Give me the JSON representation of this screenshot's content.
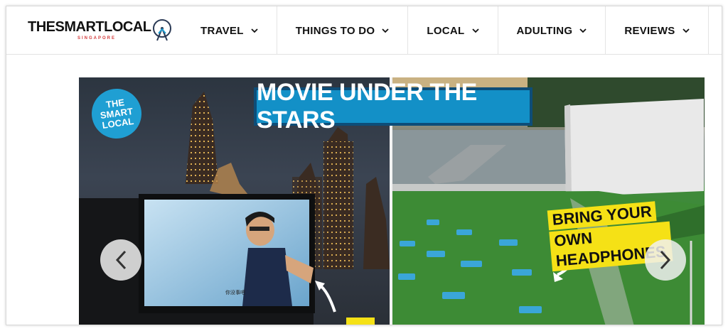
{
  "logo": {
    "brand_part1": "THE",
    "brand_part2": "SMART",
    "brand_part3": "LOCAL",
    "region": "SINGAPORE",
    "icon": "ferris-wheel-icon"
  },
  "nav": {
    "items": [
      {
        "label": "TRAVEL",
        "icon": "chevron-down-icon"
      },
      {
        "label": "THINGS TO DO",
        "icon": "chevron-down-icon"
      },
      {
        "label": "LOCAL",
        "icon": "chevron-down-icon"
      },
      {
        "label": "ADULTING",
        "icon": "chevron-down-icon"
      },
      {
        "label": "REVIEWS",
        "icon": "chevron-down-icon"
      }
    ]
  },
  "hero": {
    "badge_lines": [
      "THE",
      "SMART",
      "LOCAL"
    ],
    "title": "MOVIE UNDER THE STARS",
    "tag_line1": "BRING YOUR",
    "tag_line2": "OWN HEADPHONES",
    "subtitle_on_screen": "你没事吧",
    "prev_icon": "chevron-left-icon",
    "next_icon": "chevron-right-icon"
  },
  "colors": {
    "accent_blue": "#1390c7",
    "banner_dark": "#0d4d78",
    "tag_yellow": "#f5e116",
    "logo_red": "#d43c3c"
  }
}
